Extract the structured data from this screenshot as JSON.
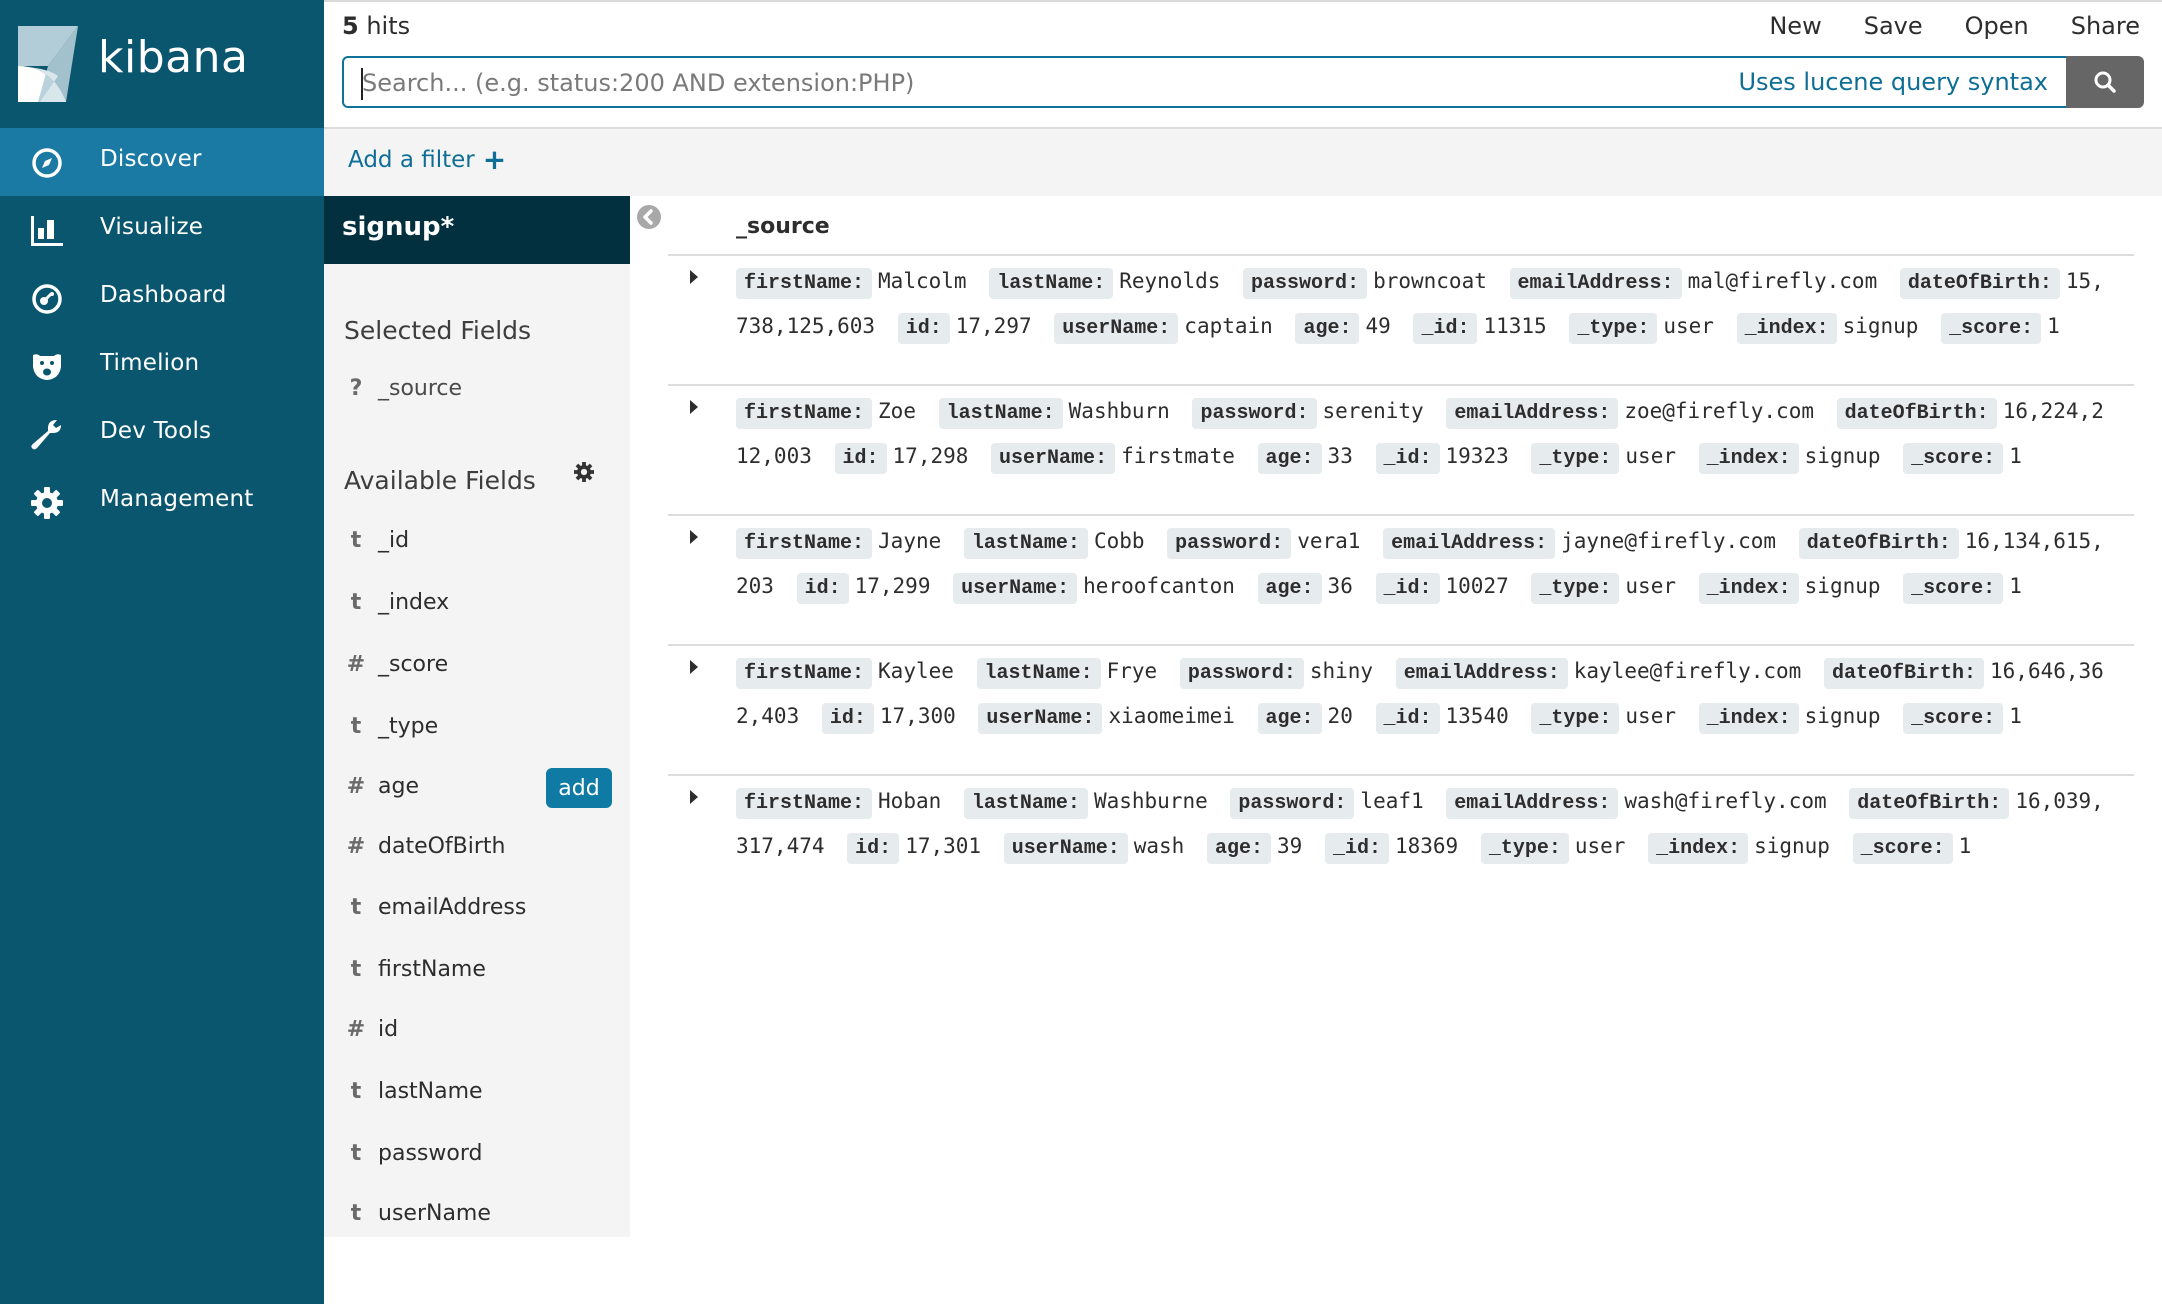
{
  "app": {
    "name": "kibana"
  },
  "sidebar": {
    "items": [
      {
        "label": "Discover",
        "icon": "compass-icon",
        "active": true
      },
      {
        "label": "Visualize",
        "icon": "bar-chart-icon",
        "active": false
      },
      {
        "label": "Dashboard",
        "icon": "dashboard-gauge-icon",
        "active": false
      },
      {
        "label": "Timelion",
        "icon": "timelion-lion-icon",
        "active": false
      },
      {
        "label": "Dev Tools",
        "icon": "wrench-icon",
        "active": false
      },
      {
        "label": "Management",
        "icon": "gear-icon",
        "active": false
      }
    ]
  },
  "topbar": {
    "hits_count": "5",
    "hits_label": " hits",
    "menu": [
      "New",
      "Save",
      "Open",
      "Share"
    ],
    "search": {
      "placeholder": "Search... (e.g. status:200 AND extension:PHP)",
      "value": "",
      "syntax_link": "Uses lucene query syntax"
    }
  },
  "filterbar": {
    "add_filter_label": "Add a filter",
    "add_filter_icon": "+"
  },
  "fieldpanel": {
    "index_pattern": "signup*",
    "selected_title": "Selected Fields",
    "selected_fields": [
      {
        "type": "?",
        "name": "_source"
      }
    ],
    "available_title": "Available Fields",
    "add_button_label": "add",
    "available_fields": [
      {
        "type": "t",
        "name": "_id"
      },
      {
        "type": "t",
        "name": "_index"
      },
      {
        "type": "#",
        "name": "_score"
      },
      {
        "type": "t",
        "name": "_type"
      },
      {
        "type": "#",
        "name": "age",
        "hovered": true
      },
      {
        "type": "#",
        "name": "dateOfBirth"
      },
      {
        "type": "t",
        "name": "emailAddress"
      },
      {
        "type": "t",
        "name": "firstName"
      },
      {
        "type": "#",
        "name": "id"
      },
      {
        "type": "t",
        "name": "lastName"
      },
      {
        "type": "t",
        "name": "password"
      },
      {
        "type": "t",
        "name": "userName"
      }
    ]
  },
  "table": {
    "column_header": "_source",
    "rows": [
      [
        [
          "firstName:",
          "Malcolm"
        ],
        [
          "lastName:",
          "Reynolds"
        ],
        [
          "password:",
          "browncoat"
        ],
        [
          "emailAddress:",
          "mal@firefly.com"
        ],
        [
          "dateOfBirth:",
          "15,738,125,603"
        ],
        [
          "id:",
          "17,297"
        ],
        [
          "userName:",
          "captain"
        ],
        [
          "age:",
          "49"
        ],
        [
          "_id:",
          "11315"
        ],
        [
          "_type:",
          "user"
        ],
        [
          "_index:",
          "signup"
        ],
        [
          "_score:",
          "1"
        ]
      ],
      [
        [
          "firstName:",
          "Zoe"
        ],
        [
          "lastName:",
          "Washburn"
        ],
        [
          "password:",
          "serenity"
        ],
        [
          "emailAddress:",
          "zoe@firefly.com"
        ],
        [
          "dateOfBirth:",
          "16,224,212,003"
        ],
        [
          "id:",
          "17,298"
        ],
        [
          "userName:",
          "firstmate"
        ],
        [
          "age:",
          "33"
        ],
        [
          "_id:",
          "19323"
        ],
        [
          "_type:",
          "user"
        ],
        [
          "_index:",
          "signup"
        ],
        [
          "_score:",
          "1"
        ]
      ],
      [
        [
          "firstName:",
          "Jayne"
        ],
        [
          "lastName:",
          "Cobb"
        ],
        [
          "password:",
          "vera1"
        ],
        [
          "emailAddress:",
          "jayne@firefly.com"
        ],
        [
          "dateOfBirth:",
          "16,134,615,203"
        ],
        [
          "id:",
          "17,299"
        ],
        [
          "userName:",
          "heroofcanton"
        ],
        [
          "age:",
          "36"
        ],
        [
          "_id:",
          "10027"
        ],
        [
          "_type:",
          "user"
        ],
        [
          "_index:",
          "signup"
        ],
        [
          "_score:",
          "1"
        ]
      ],
      [
        [
          "firstName:",
          "Kaylee"
        ],
        [
          "lastName:",
          "Frye"
        ],
        [
          "password:",
          "shiny"
        ],
        [
          "emailAddress:",
          "kaylee@firefly.com"
        ],
        [
          "dateOfBirth:",
          "16,646,362,403"
        ],
        [
          "id:",
          "17,300"
        ],
        [
          "userName:",
          "xiaomeimei"
        ],
        [
          "age:",
          "20"
        ],
        [
          "_id:",
          "13540"
        ],
        [
          "_type:",
          "user"
        ],
        [
          "_index:",
          "signup"
        ],
        [
          "_score:",
          "1"
        ]
      ],
      [
        [
          "firstName:",
          "Hoban"
        ],
        [
          "lastName:",
          "Washburne"
        ],
        [
          "password:",
          "leaf1"
        ],
        [
          "emailAddress:",
          "wash@firefly.com"
        ],
        [
          "dateOfBirth:",
          "16,039,317,474"
        ],
        [
          "id:",
          "17,301"
        ],
        [
          "userName:",
          "wash"
        ],
        [
          "age:",
          "39"
        ],
        [
          "_id:",
          "18369"
        ],
        [
          "_type:",
          "user"
        ],
        [
          "_index:",
          "signup"
        ],
        [
          "_score:",
          "1"
        ]
      ]
    ]
  },
  "colors": {
    "sidebar_bg": "#0b566f",
    "sidebar_active": "#1a7aa3",
    "index_header_bg": "#03303f",
    "accent": "#0f7299",
    "search_button": "#666666"
  }
}
